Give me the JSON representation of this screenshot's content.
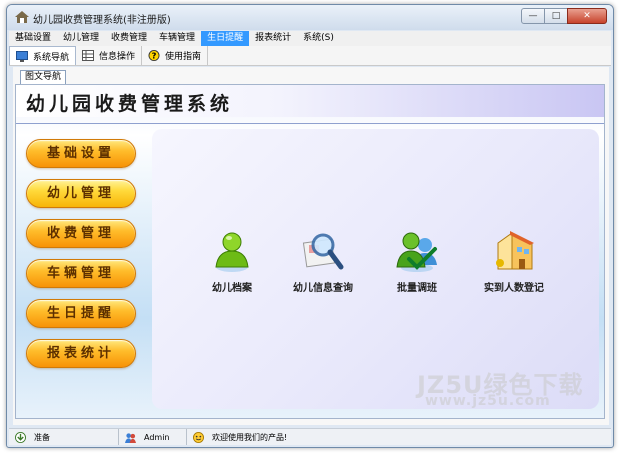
{
  "window": {
    "title": "幼儿园收费管理系统(非注册版)"
  },
  "title_controls": {
    "minimize": "—",
    "maximize": "□",
    "close": "✕"
  },
  "menu": [
    "基础设置",
    "幼儿管理",
    "收费管理",
    "车辆管理",
    "生日提醒",
    "报表统计",
    "系统(S)"
  ],
  "toolbar": {
    "items": [
      "系统导航",
      "信息操作",
      "使用指南"
    ]
  },
  "tab": {
    "label": "图文导航"
  },
  "header": {
    "title": "幼儿园收费管理系统"
  },
  "nav": [
    "基础设置",
    "幼儿管理",
    "收费管理",
    "车辆管理",
    "生日提醒",
    "报表统计"
  ],
  "features": [
    "幼儿档案",
    "幼儿信息查询",
    "批量调班",
    "实到人数登记"
  ],
  "watermark": {
    "line1": "JZ5U绿色下载",
    "line2": "www.jz5u.com"
  },
  "status": {
    "ready": "准备",
    "user": "Admin",
    "welcome": "欢迎使用我们的产品!"
  },
  "colors": {
    "menu_active": "#3399ff",
    "nav_button": "#ffbd2b",
    "panel_bg": "#c4dff5"
  }
}
